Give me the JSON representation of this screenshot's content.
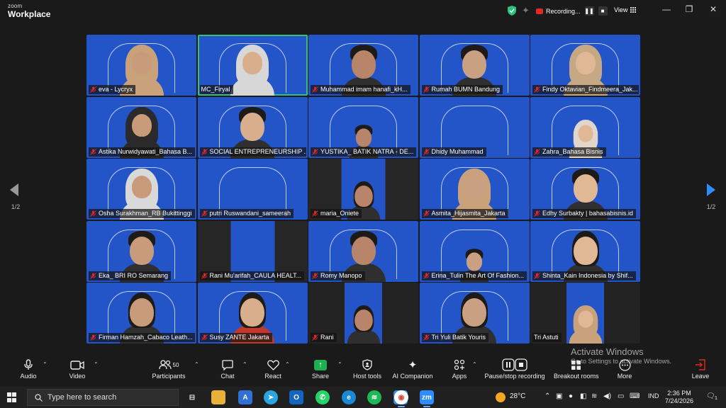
{
  "titlebar": {
    "brand_small": "zoom",
    "brand_large": "Workplace",
    "recording_label": "Recording...",
    "view_label": "View",
    "minimize": "—",
    "restore": "❐",
    "close": "✕"
  },
  "gallery": {
    "page_indicator": "1/2",
    "participants": [
      {
        "name": "eva - Lycryx",
        "look": "hijab",
        "hijab": "#c9a27c",
        "muted": true
      },
      {
        "name": "MC_Firyal",
        "look": "hijab",
        "hijab": "#d7d7d7",
        "muted": false,
        "active": true
      },
      {
        "name": "Muhammad imam hanafi_kH...",
        "look": "man",
        "muted": true
      },
      {
        "name": "Rumah BUMN Bandung",
        "look": "man",
        "muted": true
      },
      {
        "name": "Findy Oktavian_Findmeera_Jak...",
        "look": "hijab",
        "hijab": "#c6a884",
        "muted": true
      },
      {
        "name": "Astika Nurwidyawati_Bahasa B...",
        "look": "hijab",
        "hijab": "#2a2a2a",
        "muted": true
      },
      {
        "name": "SOCIAL ENTREPRENEURSHIP ...",
        "look": "man",
        "muted": true
      },
      {
        "name": "YUSTIKA_ BATIK NATRA - DE...",
        "look": "standing",
        "muted": true
      },
      {
        "name": "Dhidy Muhammad",
        "look": "empty",
        "muted": true
      },
      {
        "name": "Zahra_Bahasa Bisnis",
        "look": "hijab-small",
        "hijab": "#e0d6cc",
        "muted": true
      },
      {
        "name": "Osha Surakhman_RB Bukittinggi",
        "look": "hijab",
        "hijab": "#d9d9d9",
        "muted": true
      },
      {
        "name": "putri Ruswandani_sameerah",
        "look": "empty",
        "muted": true
      },
      {
        "name": "maria_Oniete",
        "look": "woman-small",
        "muted": true,
        "split": true
      },
      {
        "name": "Asmita_Hijasmita_Jakarta",
        "look": "hijab",
        "hijab": "#c9a27c",
        "muted": true
      },
      {
        "name": "Edhy Surbakty | bahasabisnis.id",
        "look": "man",
        "muted": true
      },
      {
        "name": "Eka_ BRI RO Semarang",
        "look": "man",
        "muted": true
      },
      {
        "name": "Rani Mu'arifah_CAULA HEALT...",
        "look": "empty",
        "muted": true,
        "split": true
      },
      {
        "name": "Romy Manopo",
        "look": "man",
        "muted": true
      },
      {
        "name": "Erina_Tulin The Art Of Fashion...",
        "look": "standing",
        "muted": true
      },
      {
        "name": "Shinta_Kain Indonesia by Shif...",
        "look": "woman",
        "muted": true
      },
      {
        "name": "Firman Hamzah_Cabaco Leath...",
        "look": "woman",
        "muted": true
      },
      {
        "name": "Susy ZANTE Jakarta",
        "look": "woman-red",
        "muted": true
      },
      {
        "name": "Rani",
        "look": "woman-small",
        "muted": true,
        "dark": true
      },
      {
        "name": "Tri Yuli Batik Youris",
        "look": "woman",
        "muted": true
      },
      {
        "name": "Tri Astuti",
        "look": "hijab-small",
        "hijab": "#c9a27c",
        "muted": false,
        "dark": true
      }
    ]
  },
  "toolbar": {
    "audio": "Audio",
    "video": "Video",
    "participants": "Participants",
    "participants_count": "50",
    "chat": "Chat",
    "react": "React",
    "share": "Share",
    "host_tools": "Host tools",
    "ai_companion": "AI Companion",
    "apps": "Apps",
    "recording": "Pause/stop recording",
    "breakout": "Breakout rooms",
    "more": "More",
    "leave": "Leave"
  },
  "watermark": {
    "title": "Activate Windows",
    "subtitle": "Go to Settings to activate Windows."
  },
  "taskbar": {
    "search_placeholder": "Type here to search",
    "weather": "28°C",
    "language": "IND",
    "time": "2:36 PM",
    "date": "7/24/2026",
    "notifications": "1"
  },
  "colors": {
    "tile_blue": "#2455c8",
    "active_border": "#2ec27e",
    "record_red": "#e02828",
    "share_green": "#1fae52"
  }
}
